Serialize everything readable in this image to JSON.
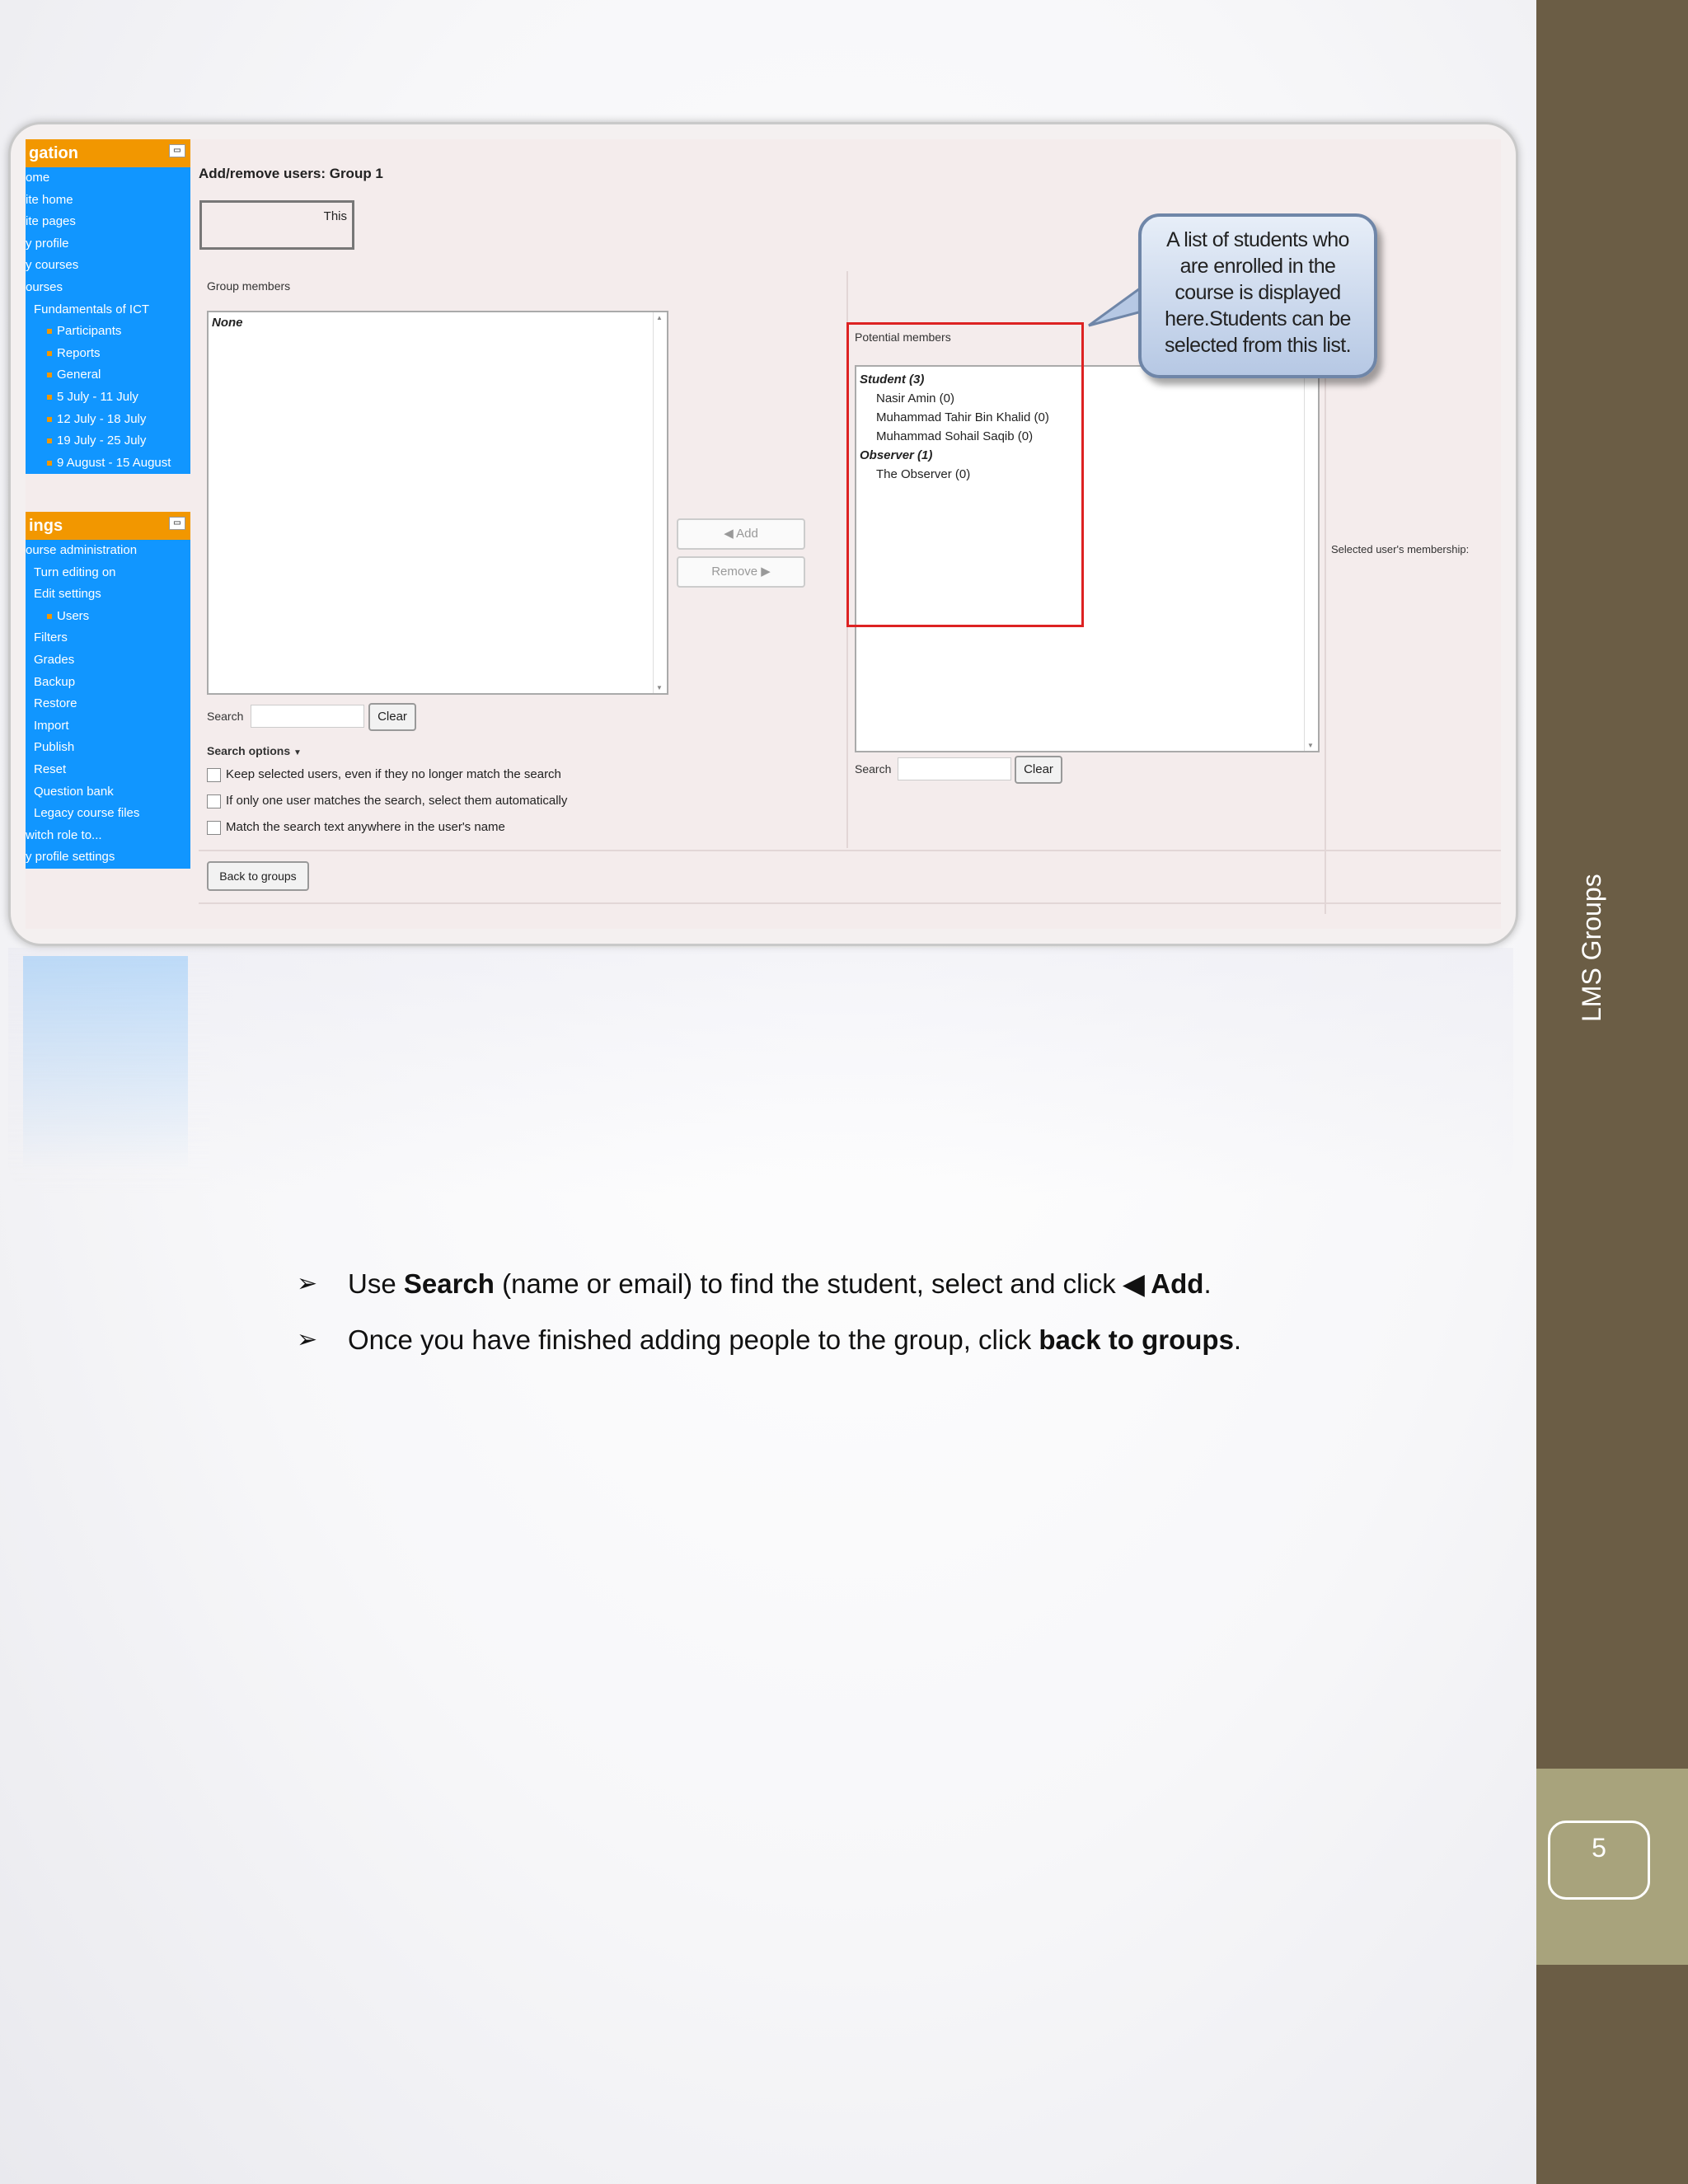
{
  "sidebar": {
    "title": "LMS Groups",
    "page_number": "5"
  },
  "screenshot": {
    "nav_block": {
      "heading": "gation",
      "items": [
        {
          "label": "ome",
          "indent": 0
        },
        {
          "label": "ite home",
          "indent": 0
        },
        {
          "label": "ite pages",
          "indent": 0
        },
        {
          "label": "y profile",
          "indent": 0
        },
        {
          "label": "y courses",
          "indent": 0
        },
        {
          "label": "ourses",
          "indent": 0
        },
        {
          "label": "Fundamentals of ICT",
          "indent": 1
        },
        {
          "label": "Participants",
          "indent": 2
        },
        {
          "label": "Reports",
          "indent": 2
        },
        {
          "label": "General",
          "indent": 2
        },
        {
          "label": "5 July - 11 July",
          "indent": 2
        },
        {
          "label": "12 July - 18 July",
          "indent": 2
        },
        {
          "label": "19 July - 25 July",
          "indent": 2
        },
        {
          "label": "9 August - 15 August",
          "indent": 2
        }
      ]
    },
    "settings_block": {
      "heading": "ings",
      "items": [
        {
          "label": "ourse administration",
          "indent": 0
        },
        {
          "label": "Turn editing on",
          "indent": 1
        },
        {
          "label": "Edit settings",
          "indent": 1
        },
        {
          "label": "Users",
          "indent": 2
        },
        {
          "label": "Filters",
          "indent": 1
        },
        {
          "label": "Grades",
          "indent": 1
        },
        {
          "label": "Backup",
          "indent": 1
        },
        {
          "label": "Restore",
          "indent": 1
        },
        {
          "label": "Import",
          "indent": 1
        },
        {
          "label": "Publish",
          "indent": 1
        },
        {
          "label": "Reset",
          "indent": 1
        },
        {
          "label": "Question bank",
          "indent": 1
        },
        {
          "label": "Legacy course files",
          "indent": 1
        },
        {
          "label": "witch role to...",
          "indent": 0
        },
        {
          "label": "y profile settings",
          "indent": 0
        }
      ]
    },
    "title": "Add/remove users: Group 1",
    "this_box": "This",
    "group_members_label": "Group members",
    "group_members_list": [
      "None"
    ],
    "search_label": "Search",
    "clear_label": "Clear",
    "search_options_label": "Search options",
    "options": [
      "Keep selected users, even if they no longer match the search",
      "If only one user matches the search, select them automatically",
      "Match the search text anywhere in the user's name"
    ],
    "add_label": "Add",
    "remove_label": "Remove",
    "back_to_groups_label": "Back to groups",
    "potential_members_label": "Potential members",
    "potential_groups": [
      {
        "group": "Student (3)",
        "members": [
          "Nasir Amin (0)",
          "Muhammad Tahir Bin Khalid (0)",
          "Muhammad Sohail Saqib (0)"
        ]
      },
      {
        "group": "Observer (1)",
        "members": [
          "The Observer (0)"
        ]
      }
    ],
    "selected_membership_label": "Selected user's membership:",
    "callout_text": "A list of students who are enrolled in the course is displayed here.Students can be selected from this list."
  },
  "instructions": {
    "line1": {
      "pre": "Use ",
      "b1": "Search",
      "mid": " (name or email) to find the student, select and click ",
      "b2": "◀ Add",
      "post": "."
    },
    "line2": {
      "pre": "Once you have finished adding people to the group, click ",
      "b1": "back to groups",
      "post": "."
    }
  },
  "colors": {
    "sidebar": "#6b5d45",
    "page_box": "#a8a37c",
    "nav_blue": "#1196ff",
    "nav_orange": "#f29700",
    "highlight_red": "#dd2222"
  }
}
